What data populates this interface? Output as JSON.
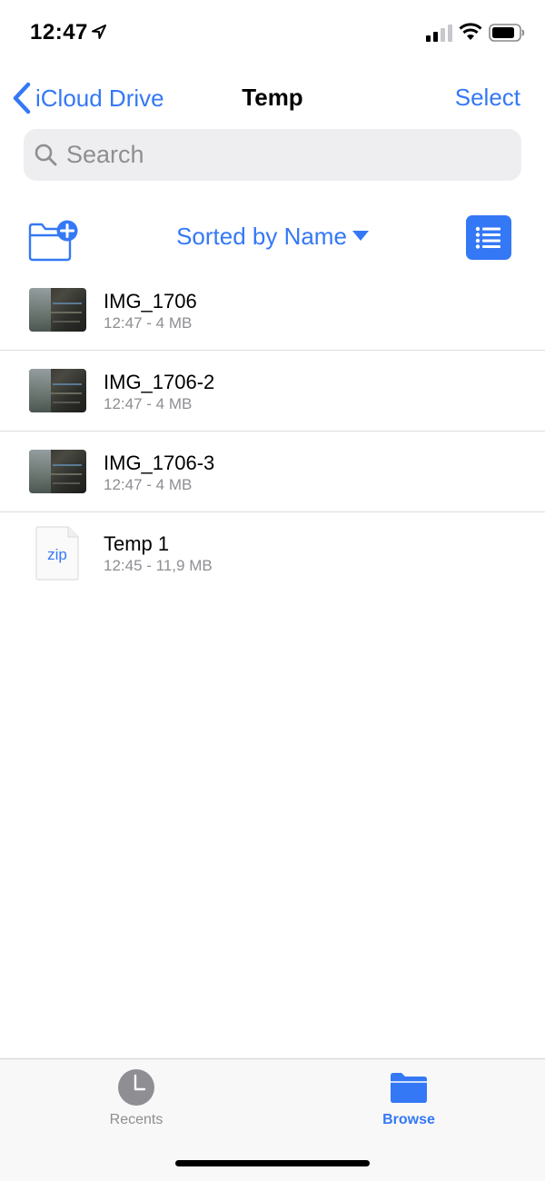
{
  "status_bar": {
    "time": "12:47",
    "location_icon": "location-arrow-icon",
    "signal_icon": "cellular-signal-icon",
    "wifi_icon": "wifi-icon",
    "battery_icon": "battery-icon"
  },
  "nav": {
    "back_label": "iCloud Drive",
    "title": "Temp",
    "select_label": "Select"
  },
  "search": {
    "placeholder": "Search"
  },
  "toolbar": {
    "new_folder_icon": "new-folder-icon",
    "sort_label": "Sorted by Name",
    "view_icon": "list-view-icon"
  },
  "files": [
    {
      "name": "IMG_1706",
      "meta": "12:47 - 4 MB",
      "kind": "image"
    },
    {
      "name": "IMG_1706-2",
      "meta": "12:47 - 4 MB",
      "kind": "image"
    },
    {
      "name": "IMG_1706-3",
      "meta": "12:47 - 4 MB",
      "kind": "image"
    },
    {
      "name": "Temp 1",
      "meta": "12:45 - 11,9 MB",
      "kind": "zip",
      "badge": "zip"
    }
  ],
  "tabs": [
    {
      "label": "Recents",
      "icon": "clock-icon",
      "active": false
    },
    {
      "label": "Browse",
      "icon": "folder-icon",
      "active": true
    }
  ],
  "colors": {
    "accent": "#3478f6",
    "secondary_text": "#8e8e93",
    "search_background": "#eeeef0"
  }
}
